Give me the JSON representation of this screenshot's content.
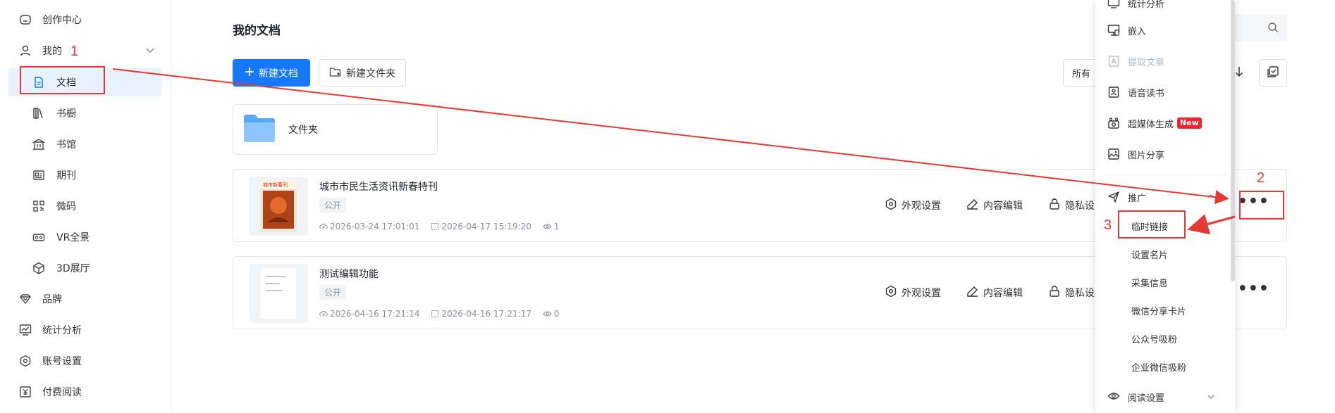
{
  "sidebar": {
    "items": [
      {
        "label": "创作中心",
        "icon": "home-icon"
      },
      {
        "label": "我的",
        "icon": "user-icon"
      },
      {
        "label": "文档",
        "icon": "document-icon"
      },
      {
        "label": "书橱",
        "icon": "bookshelf-icon"
      },
      {
        "label": "书馆",
        "icon": "library-icon"
      },
      {
        "label": "期刊",
        "icon": "journal-icon"
      },
      {
        "label": "微码",
        "icon": "qrcode-icon"
      },
      {
        "label": "VR全景",
        "icon": "vr-icon"
      },
      {
        "label": "3D展厅",
        "icon": "cube-icon"
      },
      {
        "label": "品牌",
        "icon": "diamond-icon"
      },
      {
        "label": "统计分析",
        "icon": "chart-icon"
      },
      {
        "label": "账号设置",
        "icon": "settings-icon"
      },
      {
        "label": "付费阅读",
        "icon": "yen-icon"
      }
    ]
  },
  "main": {
    "title": "我的文档",
    "new_doc_label": "新建文档",
    "new_folder_label": "新建文件夹",
    "filter_label": "所有"
  },
  "folder": {
    "name": "文件夹"
  },
  "documents": [
    {
      "title": "城市市民生活资讯新春特刊",
      "tag": "公开",
      "created": "2026-03-24 17:01:01",
      "updated": "2026-04-17 15:19:20",
      "views": "1",
      "actions": [
        "外观设置",
        "内容编辑",
        "隐私设"
      ]
    },
    {
      "title": "测试编辑功能",
      "tag": "公开",
      "created": "2026-04-16 17:21:14",
      "updated": "2026-04-16 17:21:17",
      "views": "0",
      "actions": [
        "外观设置",
        "内容编辑",
        "隐私设"
      ]
    }
  ],
  "menu": {
    "items": [
      {
        "label": "统计分析",
        "icon": "monitor-chart-icon"
      },
      {
        "label": "嵌入",
        "icon": "embed-icon"
      },
      {
        "label": "提取文章",
        "icon": "extract-icon",
        "disabled": true
      },
      {
        "label": "语音读书",
        "icon": "audio-book-icon"
      },
      {
        "label": "超媒体生成",
        "icon": "media-icon",
        "badge": "New"
      },
      {
        "label": "图片分享",
        "icon": "image-share-icon"
      },
      {
        "label": "推广",
        "icon": "promote-icon"
      },
      {
        "label": "临时链接"
      },
      {
        "label": "设置名片"
      },
      {
        "label": "采集信息"
      },
      {
        "label": "微信分享卡片"
      },
      {
        "label": "公众号吸粉"
      },
      {
        "label": "企业微信吸粉"
      },
      {
        "label": "阅读设置",
        "icon": "eye-settings-icon"
      }
    ]
  },
  "annotations": {
    "n1": "1",
    "n2": "2",
    "n3": "3",
    "color": "#e53935"
  },
  "colors": {
    "primary": "#1677ff",
    "active_bg": "#e8f1fe",
    "badge": "#f5222d"
  }
}
